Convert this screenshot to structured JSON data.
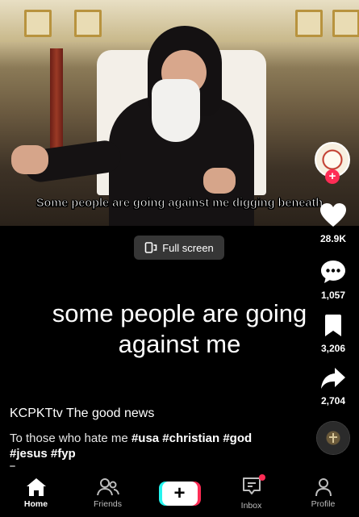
{
  "video": {
    "caption": "Some people are going against me digging beneath",
    "fullscreen_label": "Full screen",
    "overlay_text": "some people are going against me"
  },
  "actions": {
    "likes": "28.9K",
    "comments": "1,057",
    "saves": "3,206",
    "shares": "2,704"
  },
  "post": {
    "author": "KCPKTtv The good news",
    "description_prefix": "To those who hate me ",
    "hashtags": "#usa #christian #god #jesus #fyp"
  },
  "nav": {
    "items": [
      {
        "label": "Home",
        "icon": "home-icon",
        "active": true
      },
      {
        "label": "Friends",
        "icon": "friends-icon",
        "active": false
      },
      {
        "label": "",
        "icon": "create-icon",
        "active": false
      },
      {
        "label": "Inbox",
        "icon": "inbox-icon",
        "active": false
      },
      {
        "label": "Profile",
        "icon": "profile-icon",
        "active": false
      }
    ]
  },
  "colors": {
    "accent_red": "#fe2c55",
    "accent_cyan": "#25f4ee",
    "background": "#000000"
  }
}
